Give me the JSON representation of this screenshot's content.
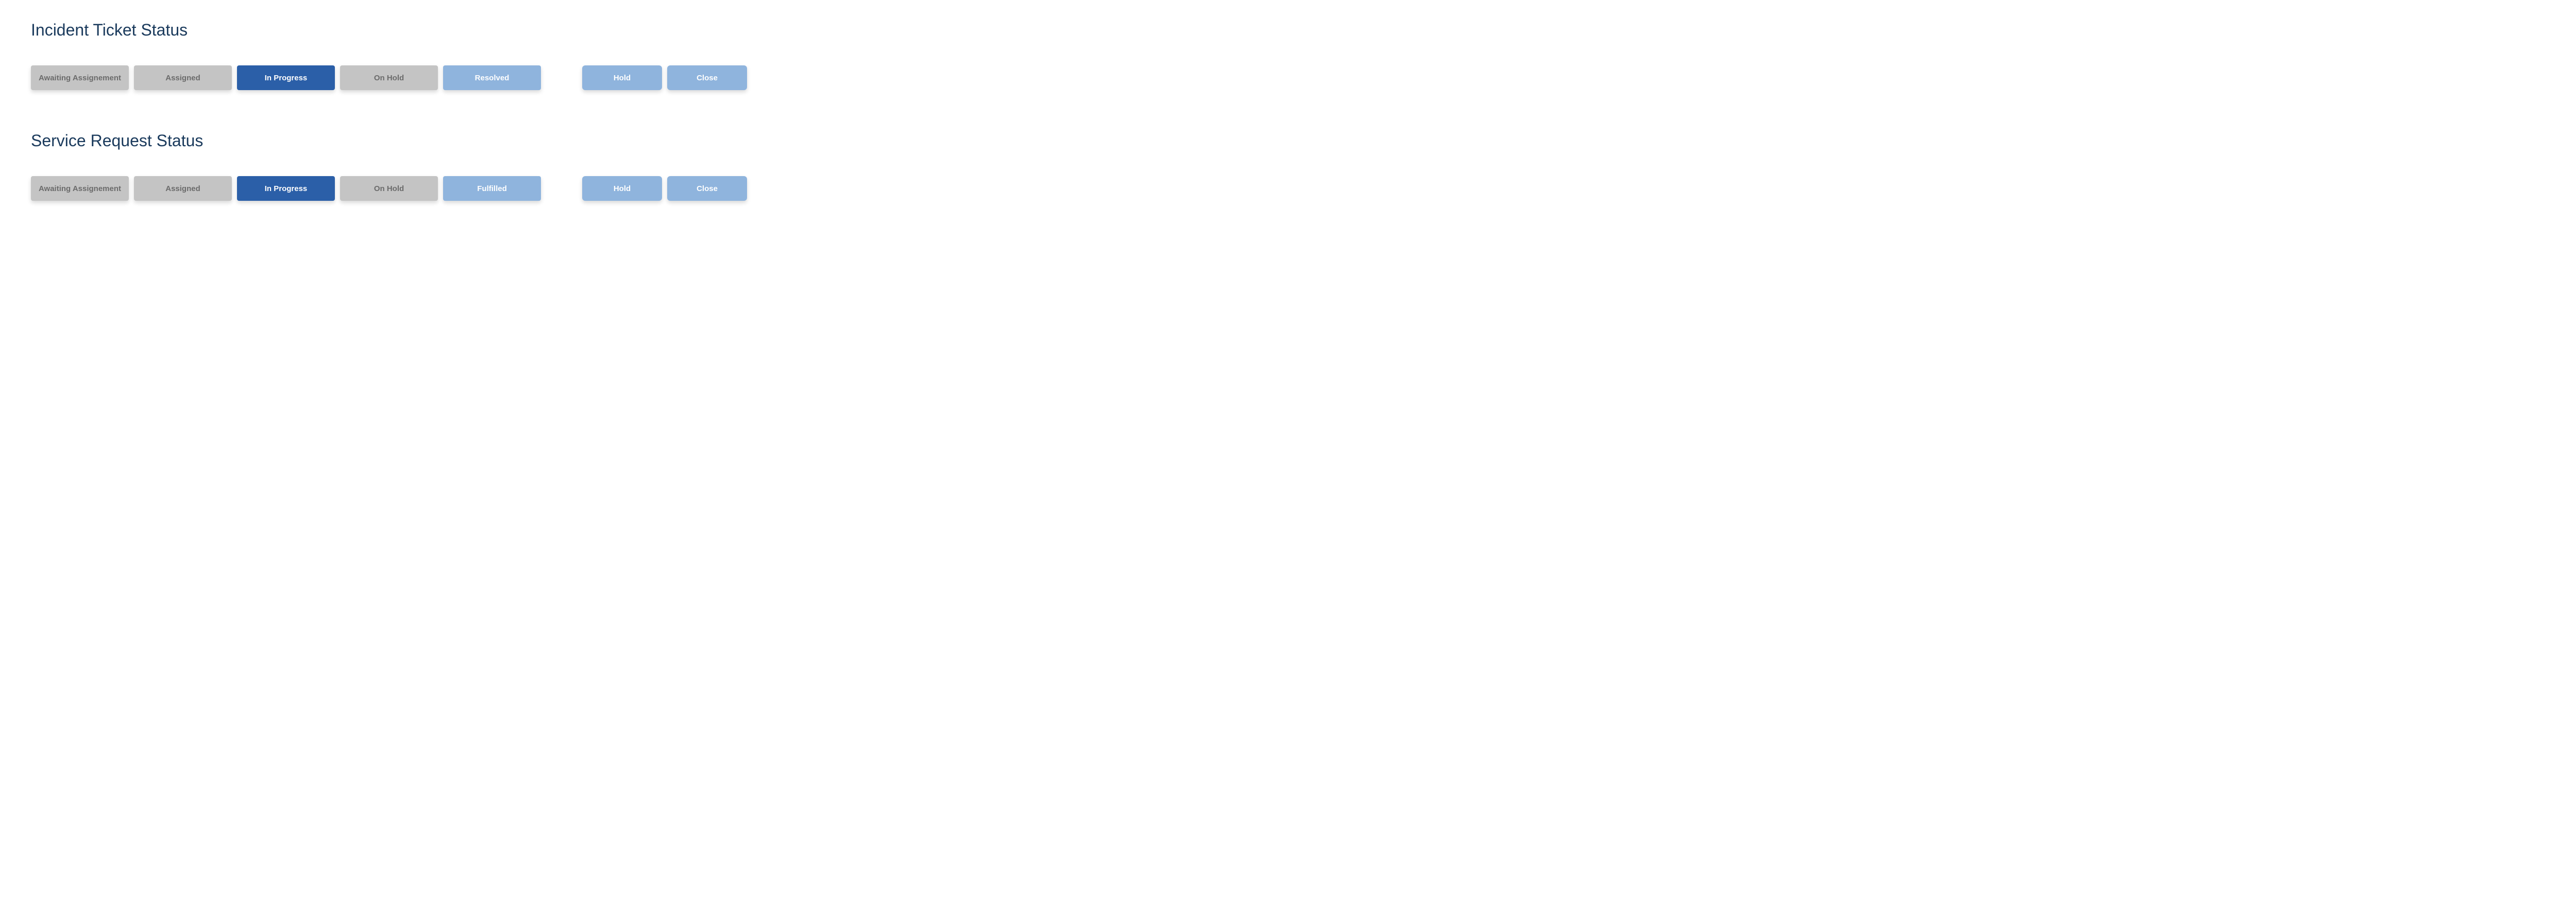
{
  "sections": [
    {
      "title": "Incident Ticket Status",
      "statuses": [
        {
          "label": "Awaiting Assignement",
          "state": "inactive"
        },
        {
          "label": "Assigned",
          "state": "inactive"
        },
        {
          "label": "In Progress",
          "state": "active"
        },
        {
          "label": "On Hold",
          "state": "inactive"
        },
        {
          "label": "Resolved",
          "state": "available"
        }
      ],
      "actions": [
        {
          "label": "Hold"
        },
        {
          "label": "Close"
        }
      ]
    },
    {
      "title": "Service Request Status",
      "statuses": [
        {
          "label": "Awaiting Assignement",
          "state": "inactive"
        },
        {
          "label": "Assigned",
          "state": "inactive"
        },
        {
          "label": "In Progress",
          "state": "active"
        },
        {
          "label": "On Hold",
          "state": "inactive"
        },
        {
          "label": "Fulfilled",
          "state": "available"
        }
      ],
      "actions": [
        {
          "label": "Hold"
        },
        {
          "label": "Close"
        }
      ]
    }
  ]
}
